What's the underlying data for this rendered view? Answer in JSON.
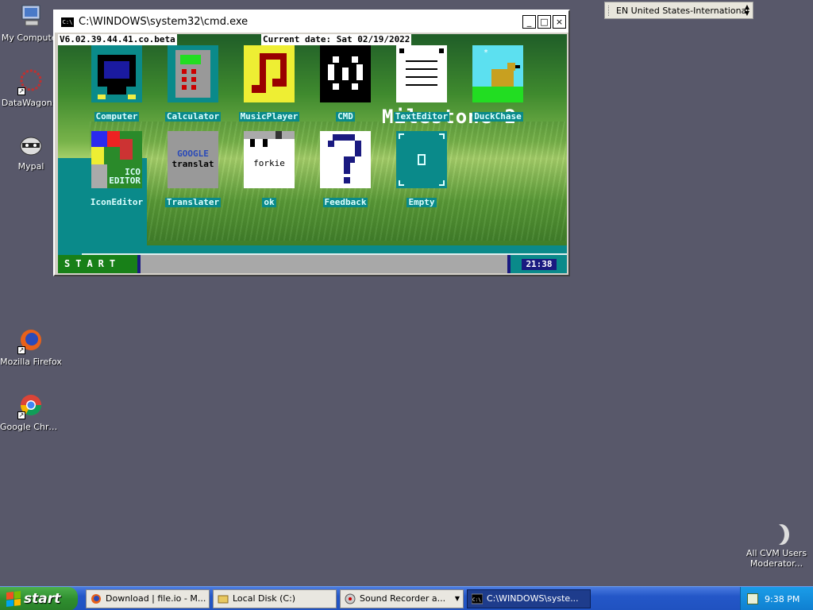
{
  "desktop": {
    "icons": [
      {
        "label": "My Computer"
      },
      {
        "label": "DataWagon..."
      },
      {
        "label": "Mypal"
      },
      {
        "label": "Mozilla Firefox"
      },
      {
        "label": "Google Chrome"
      }
    ],
    "cvm_label": "All CVM Users Moderator..."
  },
  "language_bar": {
    "text": "EN United States-International"
  },
  "cmd_window": {
    "title": "C:\\WINDOWS\\system32\\cmd.exe",
    "buttons": {
      "minimize": "_",
      "maximize": "□",
      "close": "×"
    },
    "console": {
      "version": "V6.02.39.44.41.co.beta",
      "date_line": "Current date: Sat 02/19/2022",
      "milestone_text": "Milestone 2",
      "apps": [
        {
          "name": "Computer"
        },
        {
          "name": "Calculator"
        },
        {
          "name": "MusicPlayer"
        },
        {
          "name": "CMD"
        },
        {
          "name": "TextEditor"
        },
        {
          "name": "DuckChase"
        },
        {
          "name": "IconEditor",
          "icon_text": "ICO EDITOR"
        },
        {
          "name": "Translater",
          "icon_text_1": "GOOGLE",
          "icon_text_2": "translat"
        },
        {
          "name": "ok",
          "icon_text": "forkie"
        },
        {
          "name": "Feedback"
        },
        {
          "name": "Empty"
        }
      ],
      "start_label": "START",
      "clock": "21:38"
    }
  },
  "taskbar": {
    "start_label": "start",
    "tasks": [
      {
        "label": "Download | file.io - M..."
      },
      {
        "label": "Local Disk (C:)"
      },
      {
        "label": "Sound Recorder a..."
      },
      {
        "label": "C:\\WINDOWS\\syste..."
      }
    ],
    "clock": "9:38 PM"
  },
  "colors": {
    "console_teal": "#0a8a8a",
    "desktop_bg": "#58586a",
    "taskbar_blue": "#2457c8",
    "start_green": "#2f8f2f"
  }
}
